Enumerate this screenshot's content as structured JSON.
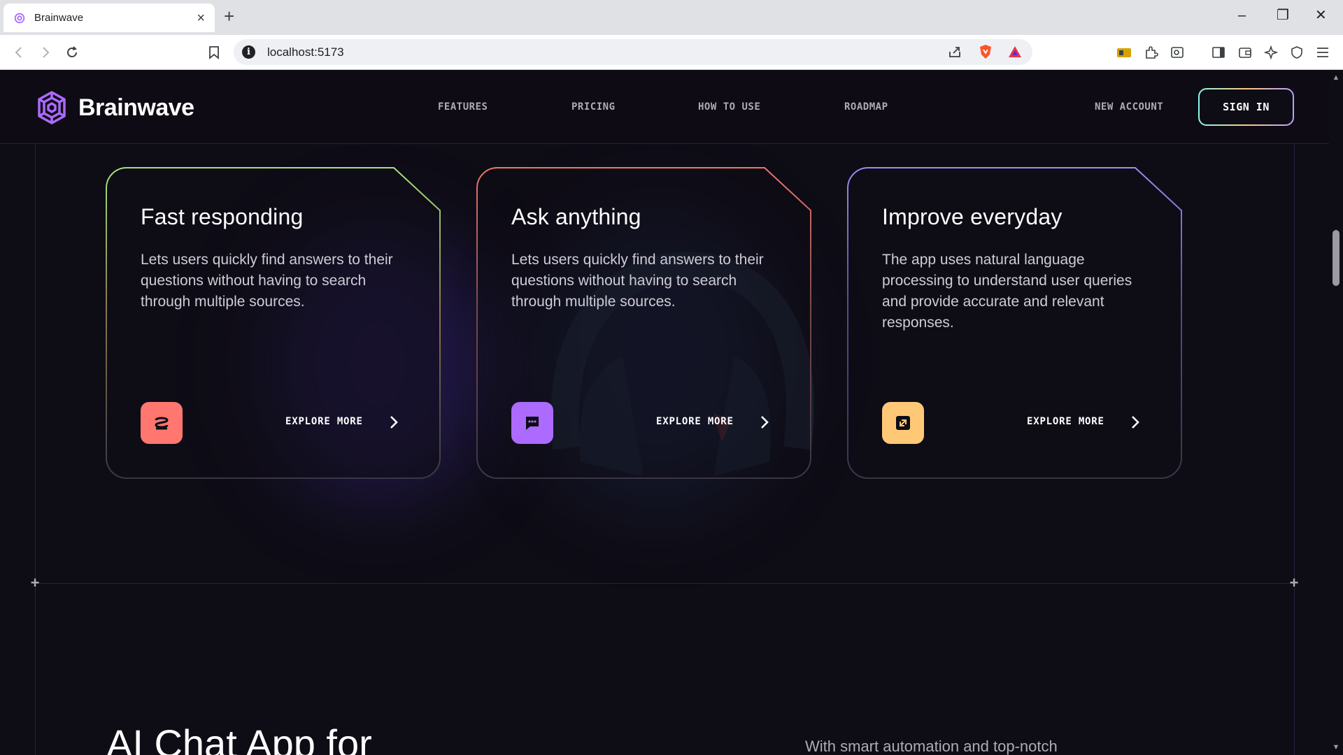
{
  "browser": {
    "tab_title": "Brainwave",
    "url": "localhost:5173"
  },
  "header": {
    "brand": "Brainwave",
    "nav": [
      "FEATURES",
      "PRICING",
      "HOW TO USE",
      "ROADMAP"
    ],
    "new_account": "NEW ACCOUNT",
    "sign_in": "SIGN IN"
  },
  "cards": [
    {
      "title": "Fast responding",
      "text": "Lets users quickly find answers to their questions without having to search through multiple sources.",
      "cta": "EXPLORE MORE",
      "icon": "plug-icon",
      "icon_color": "#ff776f"
    },
    {
      "title": "Ask anything",
      "text": "Lets users quickly find answers to their questions without having to search through multiple sources.",
      "cta": "EXPLORE MORE",
      "icon": "chat-icon",
      "icon_color": "#ac6aff"
    },
    {
      "title": "Improve everyday",
      "text": "The app uses natural language processing to understand user queries and provide accurate and relevant responses.",
      "cta": "EXPLORE MORE",
      "icon": "expand-icon",
      "icon_color": "#ffc876"
    }
  ],
  "section": {
    "heading": "AI Chat App for",
    "subtext": "With smart automation and top-notch"
  },
  "colors": {
    "background": "#0e0c15",
    "card1_border": "#a6e37a",
    "card2_border": "#f0756a",
    "card3_border": "#9b8cf5"
  }
}
